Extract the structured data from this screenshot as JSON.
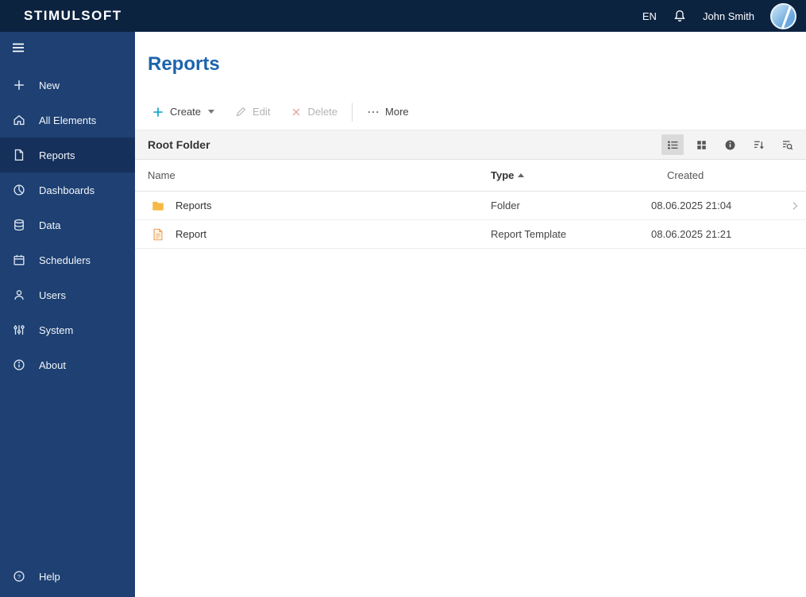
{
  "topbar": {
    "logo": "STIMULSOFT",
    "language": "EN",
    "user_name": "John Smith"
  },
  "sidebar": {
    "items": [
      {
        "label": "New",
        "icon": "plus-icon"
      },
      {
        "label": "All Elements",
        "icon": "home-icon"
      },
      {
        "label": "Reports",
        "icon": "report-icon",
        "active": true
      },
      {
        "label": "Dashboards",
        "icon": "dashboard-icon"
      },
      {
        "label": "Data",
        "icon": "database-icon"
      },
      {
        "label": "Schedulers",
        "icon": "scheduler-icon"
      },
      {
        "label": "Users",
        "icon": "users-icon"
      },
      {
        "label": "System",
        "icon": "system-sliders-icon"
      },
      {
        "label": "About",
        "icon": "about-icon"
      }
    ],
    "help": {
      "label": "Help",
      "icon": "help-icon"
    }
  },
  "main": {
    "page_title": "Reports",
    "toolbar": {
      "create_label": "Create",
      "edit_label": "Edit",
      "delete_label": "Delete",
      "more_label": "More"
    },
    "folder_bar": {
      "title": "Root Folder"
    },
    "table": {
      "headers": {
        "name": "Name",
        "type": "Type",
        "created": "Created"
      },
      "sort": {
        "column": "Type",
        "direction": "asc"
      },
      "rows": [
        {
          "icon": "folder-icon",
          "name": "Reports",
          "type": "Folder",
          "created": "08.06.2025 21:04"
        },
        {
          "icon": "report-file-icon",
          "name": "Report",
          "type": "Report Template",
          "created": "08.06.2025 21:21"
        }
      ]
    }
  },
  "colors": {
    "topbar_bg": "#0c2340",
    "sidebar_bg": "#1e4072",
    "sidebar_active_bg": "#16305c",
    "title_blue": "#1c64ad",
    "create_accent": "#00a2c7",
    "folder_yellow": "#f5b945",
    "file_orange": "#e9a05c"
  }
}
